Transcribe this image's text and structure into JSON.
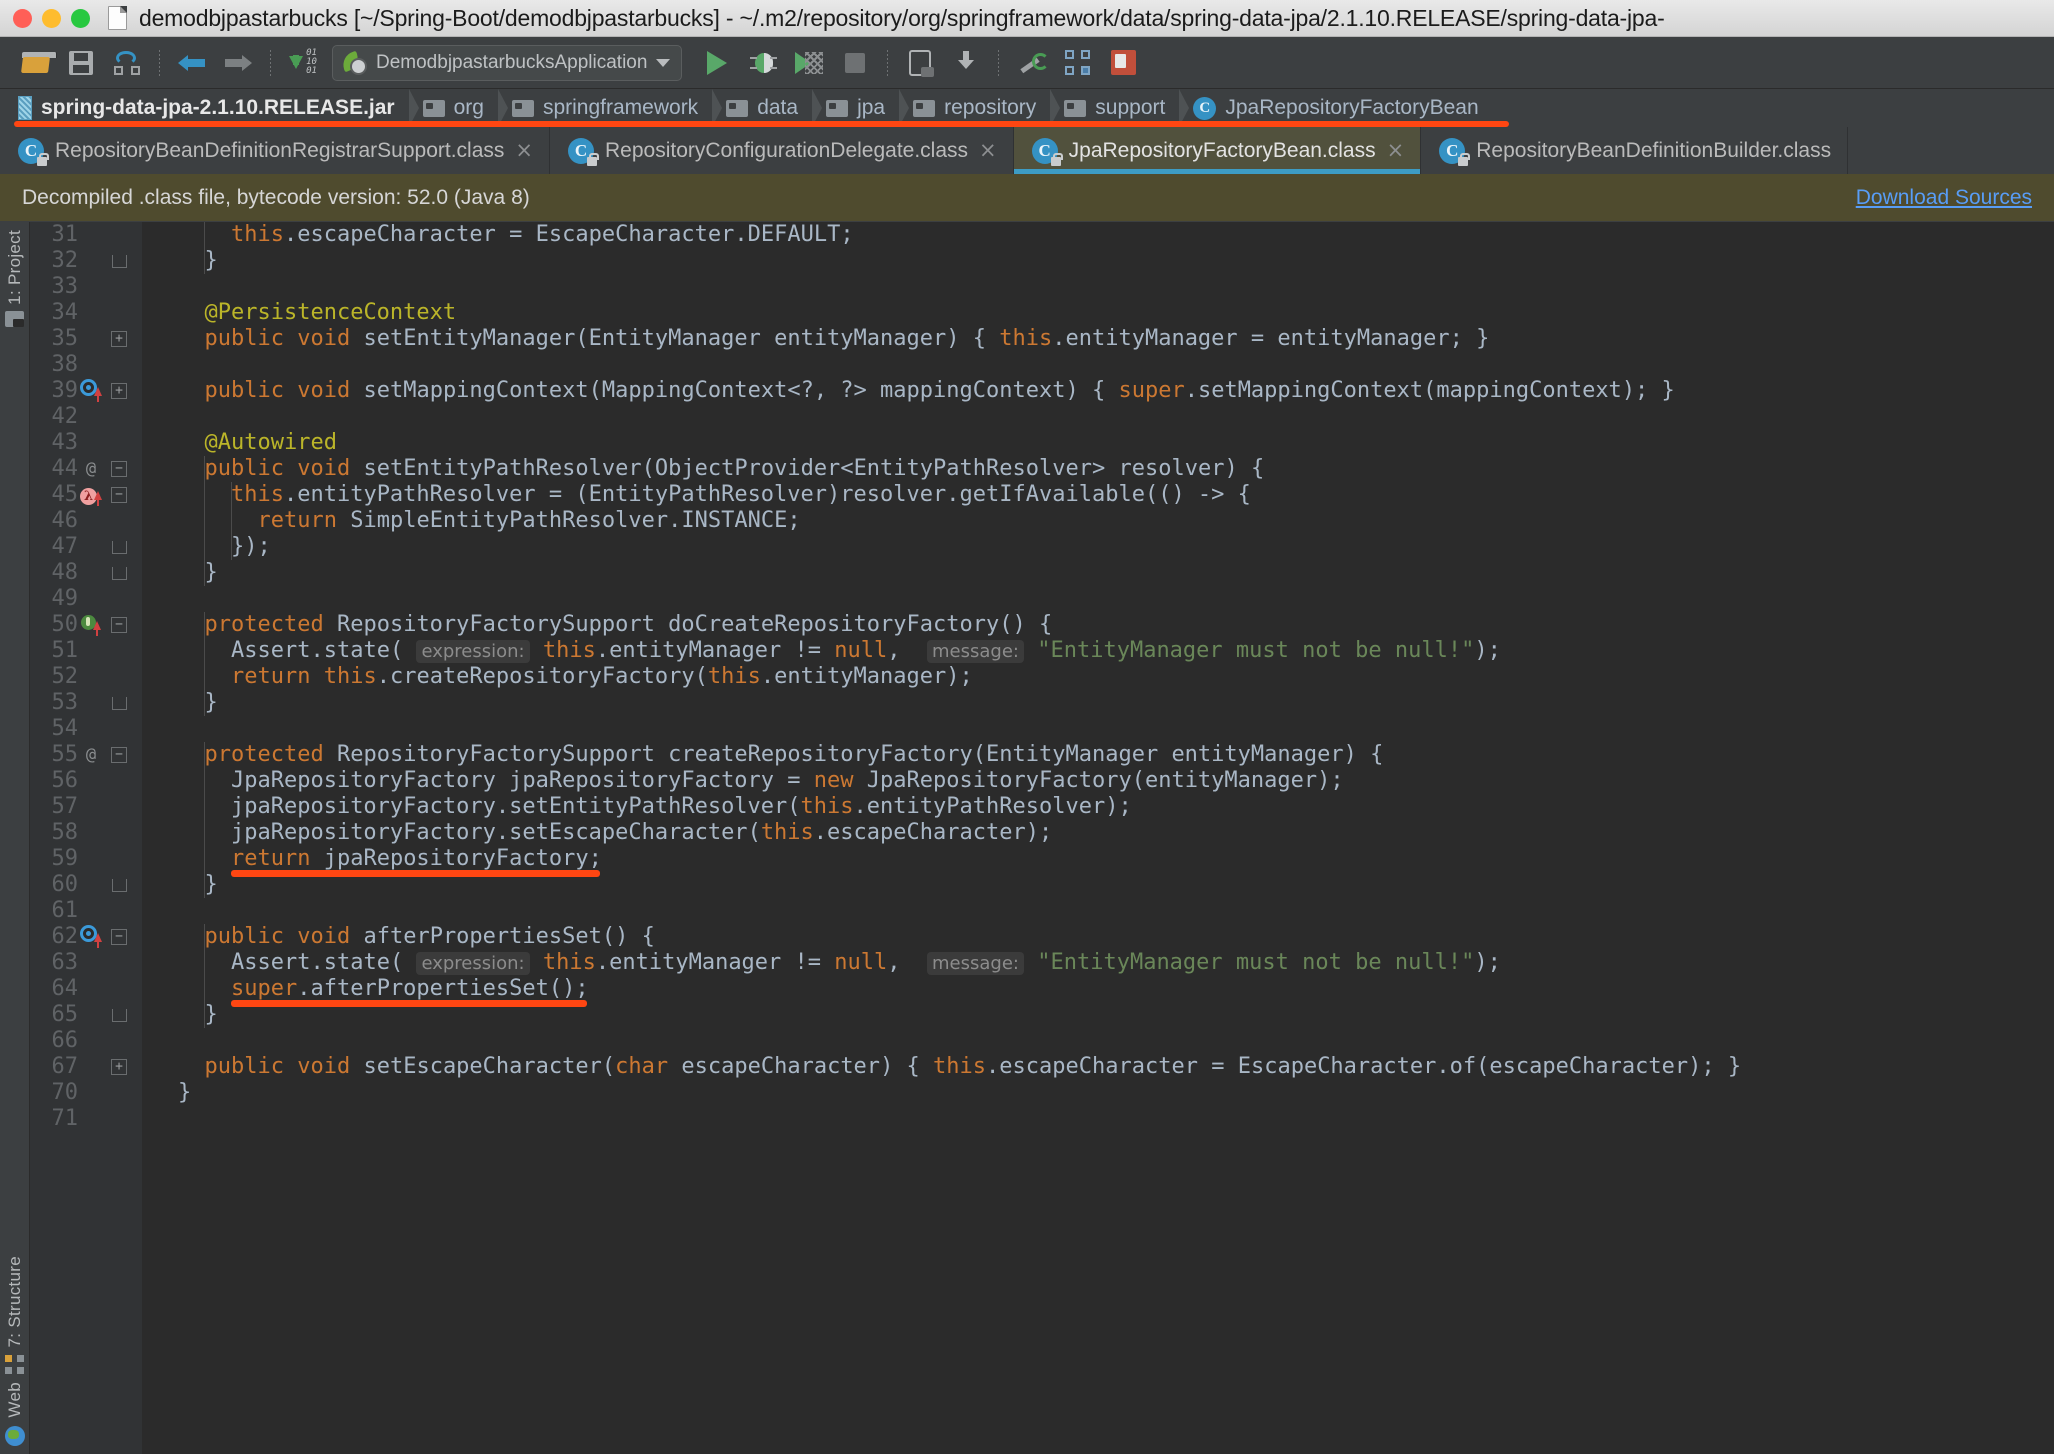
{
  "window": {
    "title": "demodbjpastarbucks [~/Spring-Boot/demodbjpastarbucks] - ~/.m2/repository/org/springframework/data/spring-data-jpa/2.1.10.RELEASE/spring-data-jpa-",
    "traffic_lights": [
      "close-button",
      "minimize-button",
      "maximize-button"
    ]
  },
  "toolbar": {
    "items": [
      {
        "name": "open-project-icon",
        "label": "open"
      },
      {
        "name": "save-all-icon",
        "label": "save"
      },
      {
        "name": "sync-icon",
        "label": "sync"
      },
      {
        "name": "back-icon",
        "label": "back"
      },
      {
        "name": "forward-icon",
        "label": "forward"
      },
      {
        "name": "compile-icon",
        "label": "compile"
      }
    ],
    "run_configuration": "DemodbjpastarbucksApplication",
    "run_buttons": [
      "run-icon",
      "debug-icon",
      "coverage-icon",
      "stop-icon"
    ],
    "right_buttons": [
      "device-icon",
      "download-icon",
      "wrench-icon",
      "structure-icon",
      "maven-icon"
    ]
  },
  "breadcrumb": {
    "items": [
      {
        "label": "spring-data-jpa-2.1.10.RELEASE.jar",
        "icon": "jar-icon"
      },
      {
        "label": "org",
        "icon": "folder-icon"
      },
      {
        "label": "springframework",
        "icon": "folder-icon"
      },
      {
        "label": "data",
        "icon": "folder-icon"
      },
      {
        "label": "jpa",
        "icon": "folder-icon"
      },
      {
        "label": "repository",
        "icon": "folder-icon"
      },
      {
        "label": "support",
        "icon": "folder-icon"
      },
      {
        "label": "JpaRepositoryFactoryBean",
        "icon": "class-icon"
      }
    ],
    "highlight_color": "#ff4612"
  },
  "editor_tabs": [
    {
      "label": "RepositoryBeanDefinitionRegistrarSupport.class",
      "active": false,
      "closable": true
    },
    {
      "label": "RepositoryConfigurationDelegate.class",
      "active": false,
      "closable": true
    },
    {
      "label": "JpaRepositoryFactoryBean.class",
      "active": true,
      "closable": true
    },
    {
      "label": "RepositoryBeanDefinitionBuilder.class",
      "active": false,
      "closable": false
    }
  ],
  "notification": {
    "message": "Decompiled .class file, bytecode version: 52.0 (Java 8)",
    "action_label": "Download Sources",
    "link_color": "#589df6",
    "background": "#4f4b2e"
  },
  "sidebar": {
    "top_items": [
      {
        "label": "1: Project",
        "icon": "project-icon"
      }
    ],
    "bottom_items": [
      {
        "label": "7: Structure",
        "icon": "structure-icon"
      },
      {
        "label": "Web",
        "icon": "web-icon"
      }
    ]
  },
  "code": {
    "language": "java",
    "theme": "darcula",
    "lines": [
      {
        "num": "31",
        "gutter": "",
        "fold": "",
        "text": "    this.escapeCharacter = EscapeCharacter.DEFAULT;"
      },
      {
        "num": "32",
        "gutter": "",
        "fold": "cap-bot",
        "text": "  }"
      },
      {
        "num": "33",
        "gutter": "",
        "fold": "",
        "text": ""
      },
      {
        "num": "34",
        "gutter": "",
        "fold": "",
        "text": "  @PersistenceContext"
      },
      {
        "num": "35",
        "gutter": "",
        "fold": "plus",
        "text": "  public void setEntityManager(EntityManager entityManager) { this.entityManager = entityManager; }"
      },
      {
        "num": "38",
        "gutter": "",
        "fold": "",
        "text": ""
      },
      {
        "num": "39",
        "gutter": "override",
        "fold": "plus",
        "text": "  public void setMappingContext(MappingContext<?, ?> mappingContext) { super.setMappingContext(mappingContext); }"
      },
      {
        "num": "42",
        "gutter": "",
        "fold": "",
        "text": ""
      },
      {
        "num": "43",
        "gutter": "",
        "fold": "",
        "text": "  @Autowired"
      },
      {
        "num": "44",
        "gutter": "at",
        "fold": "cap-top",
        "text": "  public void setEntityPathResolver(ObjectProvider<EntityPathResolver> resolver) {"
      },
      {
        "num": "45",
        "gutter": "lambda",
        "fold": "cap-top",
        "text": "    this.entityPathResolver = (EntityPathResolver)resolver.getIfAvailable(() -> {"
      },
      {
        "num": "46",
        "gutter": "",
        "fold": "",
        "text": "      return SimpleEntityPathResolver.INSTANCE;"
      },
      {
        "num": "47",
        "gutter": "",
        "fold": "cap-bot",
        "text": "    });"
      },
      {
        "num": "48",
        "gutter": "",
        "fold": "cap-bot",
        "text": "  }"
      },
      {
        "num": "49",
        "gutter": "",
        "fold": "",
        "text": ""
      },
      {
        "num": "50",
        "gutter": "bulb",
        "fold": "cap-top",
        "text": "  protected RepositoryFactorySupport doCreateRepositoryFactory() {"
      },
      {
        "num": "51",
        "gutter": "",
        "fold": "",
        "text": "    Assert.state( expression: this.entityManager != null,  message: \"EntityManager must not be null!\");"
      },
      {
        "num": "52",
        "gutter": "",
        "fold": "",
        "text": "    return this.createRepositoryFactory(this.entityManager);"
      },
      {
        "num": "53",
        "gutter": "",
        "fold": "cap-bot",
        "text": "  }"
      },
      {
        "num": "54",
        "gutter": "",
        "fold": "",
        "text": ""
      },
      {
        "num": "55",
        "gutter": "at",
        "fold": "cap-top",
        "text": "  protected RepositoryFactorySupport createRepositoryFactory(EntityManager entityManager) {"
      },
      {
        "num": "56",
        "gutter": "",
        "fold": "",
        "text": "    JpaRepositoryFactory jpaRepositoryFactory = new JpaRepositoryFactory(entityManager);"
      },
      {
        "num": "57",
        "gutter": "",
        "fold": "",
        "text": "    jpaRepositoryFactory.setEntityPathResolver(this.entityPathResolver);"
      },
      {
        "num": "58",
        "gutter": "",
        "fold": "",
        "text": "    jpaRepositoryFactory.setEscapeCharacter(this.escapeCharacter);"
      },
      {
        "num": "59",
        "gutter": "",
        "fold": "",
        "text": "    return jpaRepositoryFactory;"
      },
      {
        "num": "60",
        "gutter": "",
        "fold": "cap-bot",
        "text": "  }"
      },
      {
        "num": "61",
        "gutter": "",
        "fold": "",
        "text": ""
      },
      {
        "num": "62",
        "gutter": "override",
        "fold": "cap-top",
        "text": "  public void afterPropertiesSet() {"
      },
      {
        "num": "63",
        "gutter": "",
        "fold": "",
        "text": "    Assert.state( expression: this.entityManager != null,  message: \"EntityManager must not be null!\");"
      },
      {
        "num": "64",
        "gutter": "",
        "fold": "",
        "text": "    super.afterPropertiesSet();"
      },
      {
        "num": "65",
        "gutter": "",
        "fold": "cap-bot",
        "text": "  }"
      },
      {
        "num": "66",
        "gutter": "",
        "fold": "",
        "text": ""
      },
      {
        "num": "67",
        "gutter": "",
        "fold": "plus",
        "text": "  public void setEscapeCharacter(char escapeCharacter) { this.escapeCharacter = EscapeCharacter.of(escapeCharacter); }"
      },
      {
        "num": "70",
        "gutter": "",
        "fold": "",
        "text": "}"
      },
      {
        "num": "71",
        "gutter": "",
        "fold": "",
        "text": ""
      }
    ],
    "annotations": [
      {
        "line": "59",
        "type": "red-underline",
        "target": "return jpaRepositoryFactory;",
        "color": "#ff4612"
      },
      {
        "line": "64",
        "type": "red-underline",
        "target": "super.afterPropertiesSet();",
        "color": "#ff4612"
      }
    ],
    "parameter_hints": [
      "expression:",
      "message:"
    ]
  }
}
